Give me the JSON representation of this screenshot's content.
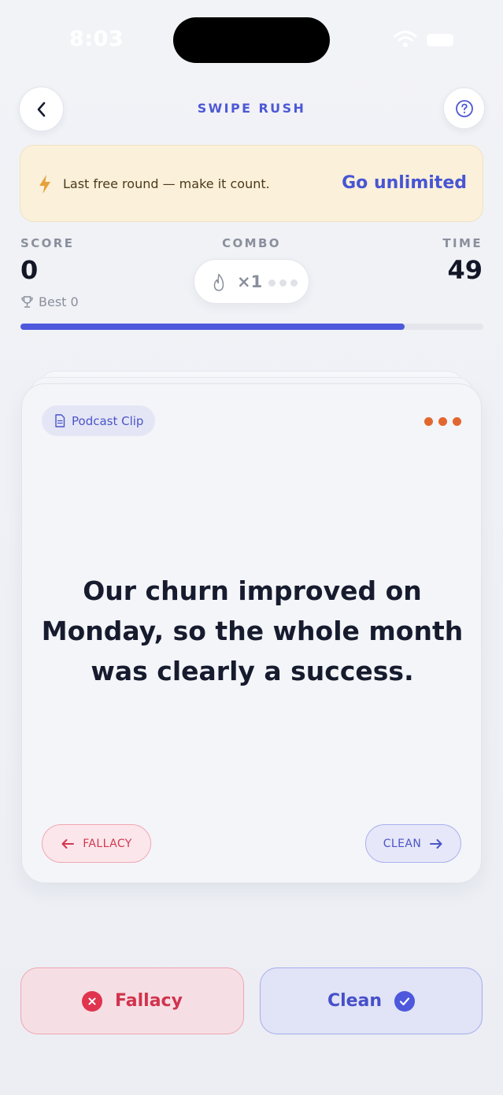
{
  "status_bar": {
    "time": "8:03"
  },
  "header": {
    "title": "SWIPE RUSH"
  },
  "banner": {
    "message": "Last free round — make it count.",
    "cta": "Go unlimited"
  },
  "stats": {
    "score_label": "SCORE",
    "score_value": "0",
    "best_text": "Best 0",
    "combo_label": "COMBO",
    "combo_value": "×1",
    "time_label": "TIME",
    "time_value": "49",
    "time_progress": 0.83
  },
  "card": {
    "source": "Podcast Clip",
    "statement": "Our churn improved on Monday, so the whole month was clearly a success.",
    "left_hint": "FALLACY",
    "right_hint": "CLEAN"
  },
  "actions": {
    "fallacy_label": "Fallacy",
    "clean_label": "Clean"
  },
  "colors": {
    "accent": "#4d58dc",
    "danger": "#d2334d",
    "banner_bg": "#fbf0d9",
    "dots": "#e2672f"
  },
  "icons": {
    "back": "chevron-left-icon",
    "help": "question-circle-icon",
    "banner": "bolt-icon",
    "best": "trophy-icon",
    "combo": "flame-icon",
    "source": "document-icon",
    "more": "more-dots-icon",
    "fallacy": "x-circle-icon",
    "clean": "check-circle-icon"
  }
}
